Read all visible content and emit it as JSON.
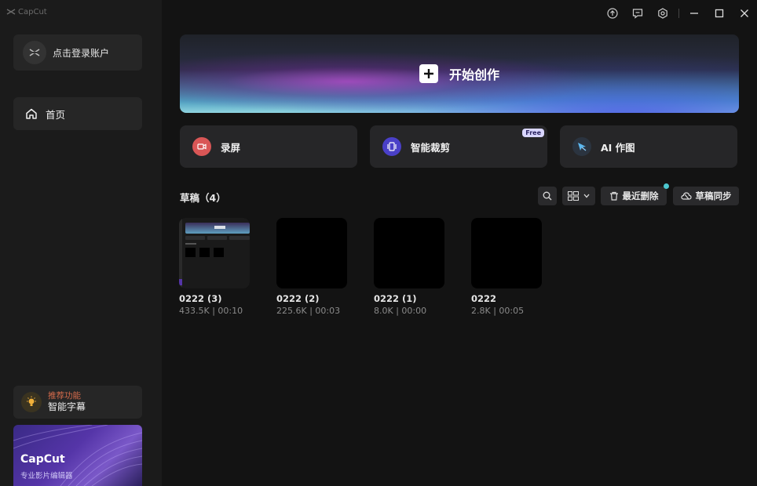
{
  "app": {
    "logo_text": "CapCut"
  },
  "sidebar": {
    "login_label": "点击登录账户",
    "nav": [
      {
        "label": "首页",
        "icon": "home-icon"
      }
    ],
    "recommend": {
      "tag": "推荐功能",
      "title": "智能字幕",
      "icon": "lightbulb-icon"
    },
    "promo": {
      "title": "CapCut",
      "subtitle": "专业影片编辑器"
    }
  },
  "titlebar": {
    "icons": [
      "upload-icon",
      "feedback-icon",
      "settings-icon",
      "minimize-icon",
      "maximize-icon",
      "close-icon"
    ]
  },
  "hero": {
    "label": "开始创作"
  },
  "features": [
    {
      "label": "录屏",
      "icon": "record-icon",
      "color": "#e05a5a"
    },
    {
      "label": "智能裁剪",
      "icon": "crop-icon",
      "color": "#5a4fd6",
      "badge": "Free"
    },
    {
      "label": "AI 作图",
      "icon": "ai-draw-icon",
      "color": "#4a9ee6"
    }
  ],
  "drafts": {
    "title": "草稿（4）",
    "tools": {
      "recent_delete": "最近删除",
      "sync": "草稿同步"
    },
    "items": [
      {
        "name": "0222 (3)",
        "meta": "433.5K | 00:10"
      },
      {
        "name": "0222 (2)",
        "meta": "225.6K | 00:03"
      },
      {
        "name": "0222 (1)",
        "meta": "8.0K | 00:00"
      },
      {
        "name": "0222",
        "meta": "2.8K | 00:05"
      }
    ]
  },
  "colors": {
    "background": "#131313",
    "sidebar": "#1b1b1b",
    "card": "#262628",
    "accent_dot": "#4cc7cf"
  }
}
